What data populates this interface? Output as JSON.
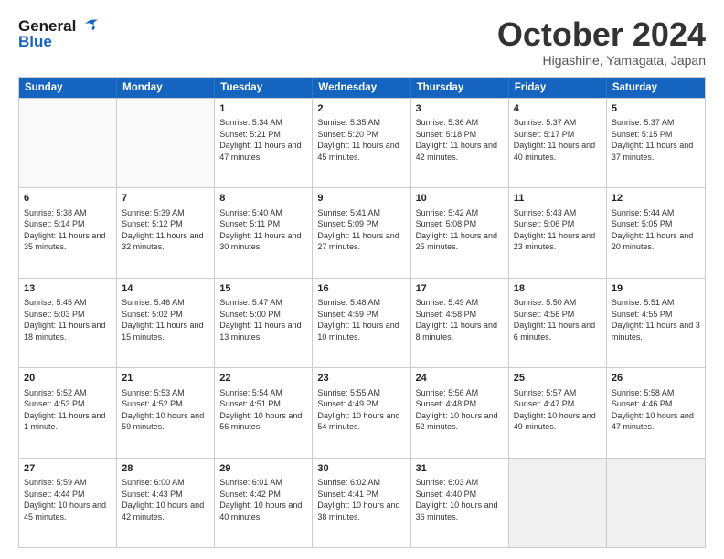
{
  "header": {
    "logo_line1": "General",
    "logo_line2": "Blue",
    "month": "October 2024",
    "location": "Higashine, Yamagata, Japan"
  },
  "days_of_week": [
    "Sunday",
    "Monday",
    "Tuesday",
    "Wednesday",
    "Thursday",
    "Friday",
    "Saturday"
  ],
  "weeks": [
    [
      {
        "day": "",
        "info": "",
        "empty": true
      },
      {
        "day": "",
        "info": "",
        "empty": true
      },
      {
        "day": "1",
        "info": "Sunrise: 5:34 AM\nSunset: 5:21 PM\nDaylight: 11 hours and 47 minutes."
      },
      {
        "day": "2",
        "info": "Sunrise: 5:35 AM\nSunset: 5:20 PM\nDaylight: 11 hours and 45 minutes."
      },
      {
        "day": "3",
        "info": "Sunrise: 5:36 AM\nSunset: 5:18 PM\nDaylight: 11 hours and 42 minutes."
      },
      {
        "day": "4",
        "info": "Sunrise: 5:37 AM\nSunset: 5:17 PM\nDaylight: 11 hours and 40 minutes."
      },
      {
        "day": "5",
        "info": "Sunrise: 5:37 AM\nSunset: 5:15 PM\nDaylight: 11 hours and 37 minutes."
      }
    ],
    [
      {
        "day": "6",
        "info": "Sunrise: 5:38 AM\nSunset: 5:14 PM\nDaylight: 11 hours and 35 minutes."
      },
      {
        "day": "7",
        "info": "Sunrise: 5:39 AM\nSunset: 5:12 PM\nDaylight: 11 hours and 32 minutes."
      },
      {
        "day": "8",
        "info": "Sunrise: 5:40 AM\nSunset: 5:11 PM\nDaylight: 11 hours and 30 minutes."
      },
      {
        "day": "9",
        "info": "Sunrise: 5:41 AM\nSunset: 5:09 PM\nDaylight: 11 hours and 27 minutes."
      },
      {
        "day": "10",
        "info": "Sunrise: 5:42 AM\nSunset: 5:08 PM\nDaylight: 11 hours and 25 minutes."
      },
      {
        "day": "11",
        "info": "Sunrise: 5:43 AM\nSunset: 5:06 PM\nDaylight: 11 hours and 23 minutes."
      },
      {
        "day": "12",
        "info": "Sunrise: 5:44 AM\nSunset: 5:05 PM\nDaylight: 11 hours and 20 minutes."
      }
    ],
    [
      {
        "day": "13",
        "info": "Sunrise: 5:45 AM\nSunset: 5:03 PM\nDaylight: 11 hours and 18 minutes."
      },
      {
        "day": "14",
        "info": "Sunrise: 5:46 AM\nSunset: 5:02 PM\nDaylight: 11 hours and 15 minutes."
      },
      {
        "day": "15",
        "info": "Sunrise: 5:47 AM\nSunset: 5:00 PM\nDaylight: 11 hours and 13 minutes."
      },
      {
        "day": "16",
        "info": "Sunrise: 5:48 AM\nSunset: 4:59 PM\nDaylight: 11 hours and 10 minutes."
      },
      {
        "day": "17",
        "info": "Sunrise: 5:49 AM\nSunset: 4:58 PM\nDaylight: 11 hours and 8 minutes."
      },
      {
        "day": "18",
        "info": "Sunrise: 5:50 AM\nSunset: 4:56 PM\nDaylight: 11 hours and 6 minutes."
      },
      {
        "day": "19",
        "info": "Sunrise: 5:51 AM\nSunset: 4:55 PM\nDaylight: 11 hours and 3 minutes."
      }
    ],
    [
      {
        "day": "20",
        "info": "Sunrise: 5:52 AM\nSunset: 4:53 PM\nDaylight: 11 hours and 1 minute."
      },
      {
        "day": "21",
        "info": "Sunrise: 5:53 AM\nSunset: 4:52 PM\nDaylight: 10 hours and 59 minutes."
      },
      {
        "day": "22",
        "info": "Sunrise: 5:54 AM\nSunset: 4:51 PM\nDaylight: 10 hours and 56 minutes."
      },
      {
        "day": "23",
        "info": "Sunrise: 5:55 AM\nSunset: 4:49 PM\nDaylight: 10 hours and 54 minutes."
      },
      {
        "day": "24",
        "info": "Sunrise: 5:56 AM\nSunset: 4:48 PM\nDaylight: 10 hours and 52 minutes."
      },
      {
        "day": "25",
        "info": "Sunrise: 5:57 AM\nSunset: 4:47 PM\nDaylight: 10 hours and 49 minutes."
      },
      {
        "day": "26",
        "info": "Sunrise: 5:58 AM\nSunset: 4:46 PM\nDaylight: 10 hours and 47 minutes."
      }
    ],
    [
      {
        "day": "27",
        "info": "Sunrise: 5:59 AM\nSunset: 4:44 PM\nDaylight: 10 hours and 45 minutes."
      },
      {
        "day": "28",
        "info": "Sunrise: 6:00 AM\nSunset: 4:43 PM\nDaylight: 10 hours and 42 minutes."
      },
      {
        "day": "29",
        "info": "Sunrise: 6:01 AM\nSunset: 4:42 PM\nDaylight: 10 hours and 40 minutes."
      },
      {
        "day": "30",
        "info": "Sunrise: 6:02 AM\nSunset: 4:41 PM\nDaylight: 10 hours and 38 minutes."
      },
      {
        "day": "31",
        "info": "Sunrise: 6:03 AM\nSunset: 4:40 PM\nDaylight: 10 hours and 36 minutes."
      },
      {
        "day": "",
        "info": "",
        "empty": true
      },
      {
        "day": "",
        "info": "",
        "empty": true
      }
    ]
  ]
}
